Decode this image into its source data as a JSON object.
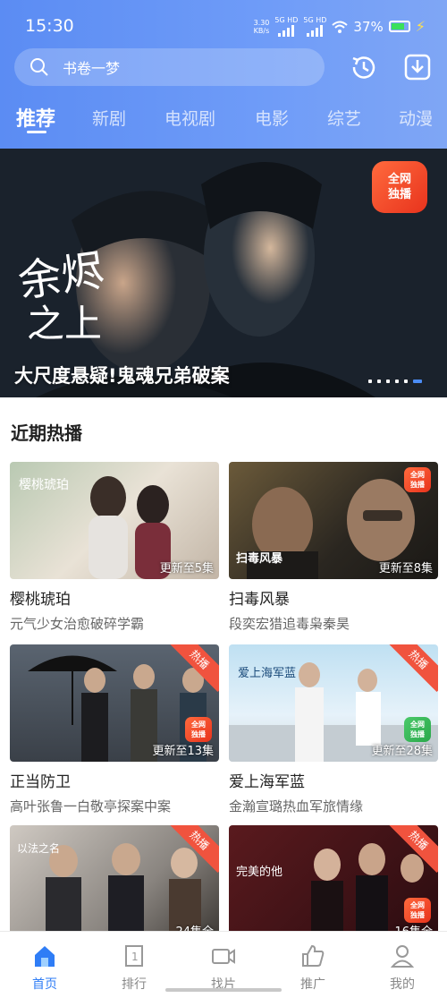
{
  "status": {
    "time": "15:30",
    "net_speed": "3.30",
    "net_unit": "KB/s",
    "sig1": "5G HD",
    "sig2": "5G HD",
    "battery": "37%"
  },
  "search": {
    "placeholder": "书卷一梦"
  },
  "tabs": [
    "推荐",
    "新剧",
    "电视剧",
    "电影",
    "综艺",
    "动漫"
  ],
  "banner": {
    "caption": "大尺度悬疑!鬼魂兄弟破案",
    "badge_line1": "全网",
    "badge_line2": "独播",
    "total_slides": 6,
    "active_slide": 6
  },
  "section": {
    "title": "近期热播"
  },
  "cards": [
    {
      "title": "樱桃琥珀",
      "subtitle": "元气少女治愈破碎学霸",
      "update": "更新至5集",
      "hot": ""
    },
    {
      "title": "扫毒风暴",
      "subtitle": "段奕宏猎追毒枭秦昊",
      "update": "更新至8集",
      "hot": ""
    },
    {
      "title": "正当防卫",
      "subtitle": "高叶张鲁一白敬亭探案中案",
      "update": "更新至13集",
      "hot": "热播"
    },
    {
      "title": "爱上海军蓝",
      "subtitle": "金瀚宣璐热血军旅情缘",
      "update": "更新至28集",
      "hot": "热播"
    },
    {
      "title": "",
      "subtitle": "",
      "update": "24集全",
      "hot": "热播"
    },
    {
      "title": "",
      "subtitle": "",
      "update": "16集全",
      "hot": "热播"
    }
  ],
  "nav": [
    "首页",
    "排行",
    "找片",
    "推广",
    "我的"
  ],
  "colors": {
    "accent": "#2f7df6",
    "header": "#6f9cf8",
    "hot": "#f0533e"
  }
}
